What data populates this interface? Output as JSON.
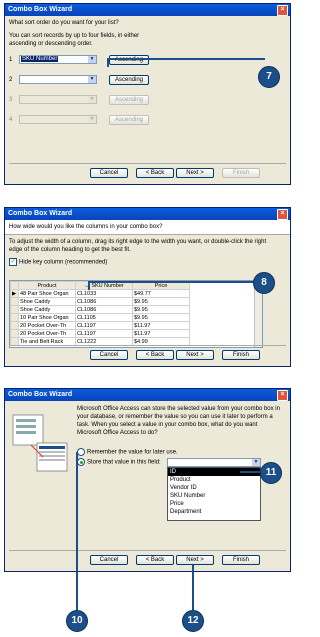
{
  "w1": {
    "title": "Combo Box Wizard",
    "header_text": "What sort order do you want for your list?",
    "instructions": "You can sort records by up to four fields, in either ascending or descending order.",
    "rows": [
      {
        "num": "1",
        "value": "SKU Number",
        "button": "Ascending"
      },
      {
        "num": "2",
        "value": "",
        "button": "Ascending"
      },
      {
        "num": "3",
        "value": "",
        "button": "Ascending"
      },
      {
        "num": "4",
        "value": "",
        "button": "Ascending"
      }
    ],
    "buttons": {
      "cancel": "Cancel",
      "back": "< Back",
      "next": "Next >",
      "finish": "Finish"
    }
  },
  "w2": {
    "title": "Combo Box Wizard",
    "header_text": "How wide would you like the columns in your combo box?",
    "instructions": "To adjust the width of a column, drag its right edge to the width you want, or double-click the right edge of the column heading to get the best fit.",
    "hide_key": "Hide key column (recommended)",
    "columns": [
      "Product",
      "SKU Number",
      "Price"
    ],
    "rows": [
      [
        "48 Pair Shoe Organ",
        "CL1033",
        "$49.77"
      ],
      [
        "Shoe Caddy",
        "CL1086",
        "$9.95"
      ],
      [
        "Shoe Caddy",
        "CL1086",
        "$9.95"
      ],
      [
        "10 Pair Shoe Organ",
        "CL1105",
        "$9.95"
      ],
      [
        "20 Pocket Over-Th",
        "CL1197",
        "$11.97"
      ],
      [
        "20 Pocket Over-Th",
        "CL1197",
        "$11.97"
      ],
      [
        "Tie and Belt Rack",
        "CL1222",
        "$4.99"
      ]
    ],
    "buttons": {
      "cancel": "Cancel",
      "back": "< Back",
      "next": "Next >",
      "finish": "Finish"
    }
  },
  "w3": {
    "title": "Combo Box Wizard",
    "description": "Microsoft Office Access can store the selected value from your combo box in your database, or remember the value so you can use it later to perform a task. When you select a value in your combo box, what do you want Microsoft Office Access to do?",
    "option_remember": "Remember the value for later use.",
    "option_store": "Store that value in this field:",
    "field_list": [
      "ID",
      "Product",
      "Vendor ID",
      "SKU Number",
      "Price",
      "Department"
    ],
    "buttons": {
      "cancel": "Cancel",
      "back": "< Back",
      "next": "Next >",
      "finish": "Finish"
    }
  },
  "callouts": {
    "c7": "7",
    "c8": "8",
    "c10": "10",
    "c11": "11",
    "c12": "12"
  },
  "colors": {
    "callout": "#1c4f8a",
    "title_bar": "#0a5ce0"
  }
}
